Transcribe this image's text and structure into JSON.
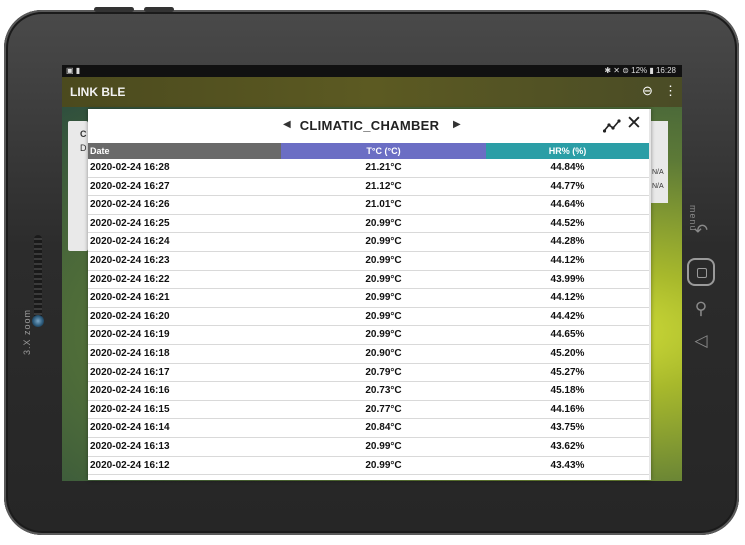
{
  "status_bar": {
    "left": "▣ ▮",
    "right": "✱ ✕ ⊜ 12% ▮ 16:28"
  },
  "app": {
    "title": "LINK BLE"
  },
  "background": {
    "card_letter": "C",
    "card_sub": "D",
    "right_na_1": "N/A",
    "right_na_2": "N/A"
  },
  "dialog": {
    "title": "CLIMATIC_CHAMBER",
    "prev_icon": "chevron-left-icon",
    "next_icon": "chevron-right-icon",
    "chart_icon": "chart-line-icon",
    "close_icon": "close-icon",
    "colors": {
      "date_header": "#6a6a6a",
      "temp_header": "#6b6ec4",
      "hr_header": "#2b9ea6"
    },
    "columns": {
      "date": "Date",
      "temp": "T°C (°C)",
      "hr": "HR% (%)"
    },
    "rows": [
      {
        "date": "2020-02-24 16:28",
        "temp": "21.21°C",
        "hr": "44.84%"
      },
      {
        "date": "2020-02-24 16:27",
        "temp": "21.12°C",
        "hr": "44.77%"
      },
      {
        "date": "2020-02-24 16:26",
        "temp": "21.01°C",
        "hr": "44.64%"
      },
      {
        "date": "2020-02-24 16:25",
        "temp": "20.99°C",
        "hr": "44.52%"
      },
      {
        "date": "2020-02-24 16:24",
        "temp": "20.99°C",
        "hr": "44.28%"
      },
      {
        "date": "2020-02-24 16:23",
        "temp": "20.99°C",
        "hr": "44.12%"
      },
      {
        "date": "2020-02-24 16:22",
        "temp": "20.99°C",
        "hr": "43.99%"
      },
      {
        "date": "2020-02-24 16:21",
        "temp": "20.99°C",
        "hr": "44.12%"
      },
      {
        "date": "2020-02-24 16:20",
        "temp": "20.99°C",
        "hr": "44.42%"
      },
      {
        "date": "2020-02-24 16:19",
        "temp": "20.99°C",
        "hr": "44.65%"
      },
      {
        "date": "2020-02-24 16:18",
        "temp": "20.90°C",
        "hr": "45.20%"
      },
      {
        "date": "2020-02-24 16:17",
        "temp": "20.79°C",
        "hr": "45.27%"
      },
      {
        "date": "2020-02-24 16:16",
        "temp": "20.73°C",
        "hr": "45.18%"
      },
      {
        "date": "2020-02-24 16:15",
        "temp": "20.77°C",
        "hr": "44.16%"
      },
      {
        "date": "2020-02-24 16:14",
        "temp": "20.84°C",
        "hr": "43.75%"
      },
      {
        "date": "2020-02-24 16:13",
        "temp": "20.99°C",
        "hr": "43.62%"
      },
      {
        "date": "2020-02-24 16:12",
        "temp": "20.99°C",
        "hr": "43.43%"
      }
    ]
  },
  "device": {
    "zoom_label": "3.X zoom",
    "menu_label": "menu"
  }
}
